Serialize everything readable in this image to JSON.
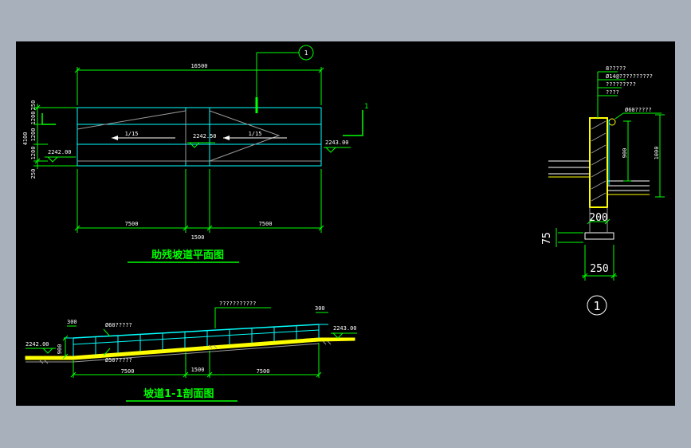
{
  "colors": {
    "frame": "#a7b0bb",
    "background": "#000000",
    "dimension": "#00ff00",
    "outline": "#00ffff",
    "wall": "#ffff00",
    "text": "#ffffff",
    "grey": "#9a9a9a"
  },
  "plan": {
    "title": "助残坡道平面图",
    "overall_length": "16500",
    "left_segment": "7500",
    "middle_segment": "1500",
    "right_segment": "7500",
    "slope_left": "1/15",
    "slope_right": "1/15",
    "level_left": "2242.00",
    "level_middle": "2242.50",
    "level_right": "2243.00",
    "width_total": "4100",
    "width_parts": [
      "250",
      "1200",
      "1200",
      "1200",
      "250"
    ],
    "section_mark": "1",
    "detail_callout": "1"
  },
  "section": {
    "title": "坡道1-1剖面图",
    "note_top": "???????????",
    "rail_top": "Ø60?????",
    "rail_bottom": "Ø50?????",
    "left_length": "7500",
    "middle_length": "1500",
    "right_length": "7500",
    "level_left": "2242.00",
    "level_right": "2243.00",
    "rail_height": "900",
    "ext_left": "300",
    "ext_right": "300"
  },
  "detail": {
    "notes": [
      "8?????",
      "Ø14@??????????",
      "?????????",
      "????"
    ],
    "rail_label": "Ø60?????",
    "height_inner": "900",
    "height_outer": "1000",
    "wall_thickness": "200",
    "footing_height": "75",
    "footing_width": "250",
    "number": "1"
  }
}
